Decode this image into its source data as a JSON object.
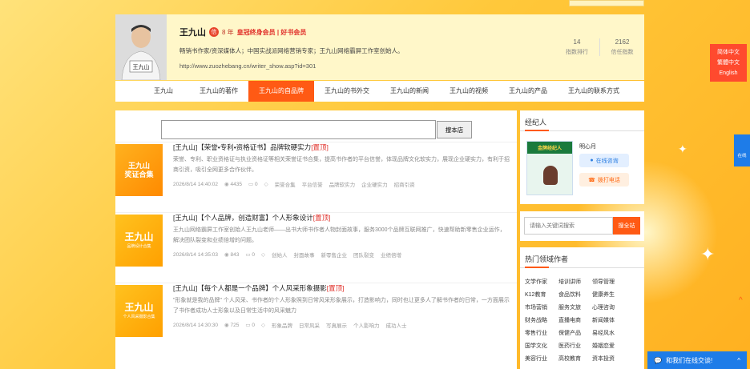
{
  "header": {
    "name": "王九山",
    "badge": "信",
    "years": "8 年",
    "vip": "皇冠终身会员 | 好书会员",
    "desc": "畅销书作家/资深媒体人；中国实战派网络营销专家；王九山网络霸屏工作室创始人。",
    "url": "http://www.zuozhebang.cn/writer_show.asp?id=301",
    "stats": [
      {
        "value": "14",
        "label": "指数排行"
      },
      {
        "value": "2162",
        "label": "信任指数"
      }
    ]
  },
  "nav": [
    "王九山",
    "王九山的著作",
    "王九山的自品牌",
    "王九山的书外交",
    "王九山的新闻",
    "王九山的视频",
    "王九山的产品",
    "王九山的联系方式"
  ],
  "search": {
    "button": "搜本店",
    "placeholder": ""
  },
  "articles": [
    {
      "thumb_line1": "王九山",
      "thumb_line2": "奖证合集",
      "title": "[王九山]【荣誉•专利•资格证书】品牌软硬实力",
      "tag": "[置顶]",
      "desc": "荣誉、专利、职业资格证与执业资格证等相关荣誉证书合集，提高书作者的平台信誉，体现品牌文化软实力，展现企业硬实力，有利于招商引资，吸引全网更多合作伙伴。",
      "date": "2026/8/14 14:40:02",
      "views": "4435",
      "comments": "0",
      "tags": [
        "荣誉合集",
        "平台信誉",
        "品牌软实力",
        "企业硬实力",
        "招商引资"
      ]
    },
    {
      "thumb_line1": "王九山",
      "thumb_line2": "品牌设计合集",
      "title": "[王九山]【个人品牌，创造财富】个人形象设计",
      "tag": "[置顶]",
      "desc": "王九山网络霸屏工作室创始人王九山老师——出书大师书作者人物封面故事，服务3000个品牌互联网推广，快速帮助新零售企业运作，解决团队裂变和业绩倍增的问题。",
      "date": "2026/8/14 14:35:03",
      "views": "843",
      "comments": "0",
      "tags": [
        "创始人",
        "封面故事",
        "新零售企业",
        "团队裂变",
        "业绩倍增"
      ]
    },
    {
      "thumb_line1": "王九山",
      "thumb_line2": "个人风采摄影合集",
      "title": "[王九山]【每个人都是一个品牌】个人风采形象摄影",
      "tag": "[置顶]",
      "desc": "\"形象就是我的品牌\" 个人风采、书作者的个人形象照到日常风采形象展示，打造影响力，同时也让更多人了解书作者的日常，一方面展示了书作者成功人士形象以及日常生活中的风采魅力",
      "date": "2026/8/14 14:30:30",
      "views": "725",
      "comments": "0",
      "tags": [
        "形象品牌",
        "日常风采",
        "写真展示",
        "个人影响力",
        "成功人士"
      ]
    }
  ],
  "agent_panel": {
    "title": "经纪人",
    "book_title": "金牌经纪人",
    "agent_name": "明心月",
    "consult": "在线咨询",
    "call": "拨打电话"
  },
  "keyword_search": {
    "placeholder": "请输入关键词搜索",
    "button": "搜全站"
  },
  "hot_panel": {
    "title": "热门领域作者",
    "categories": [
      "文学作家",
      "培训讲师",
      "领导管理",
      "K12教育",
      "食品饮料",
      "健康养生",
      "市场营销",
      "服务文旅",
      "心理咨询",
      "财务战略",
      "直播电商",
      "新闻媒体",
      "零售行业",
      "保健产品",
      "易经风水",
      "国学文化",
      "医药行业",
      "婚姻恋爱",
      "美容行业",
      "高校教育",
      "资本投资"
    ]
  },
  "lang": [
    "简体中文",
    "繁體中文",
    "English"
  ],
  "side_consult": "在线",
  "chat": {
    "label": "和我们在线交谈!"
  }
}
